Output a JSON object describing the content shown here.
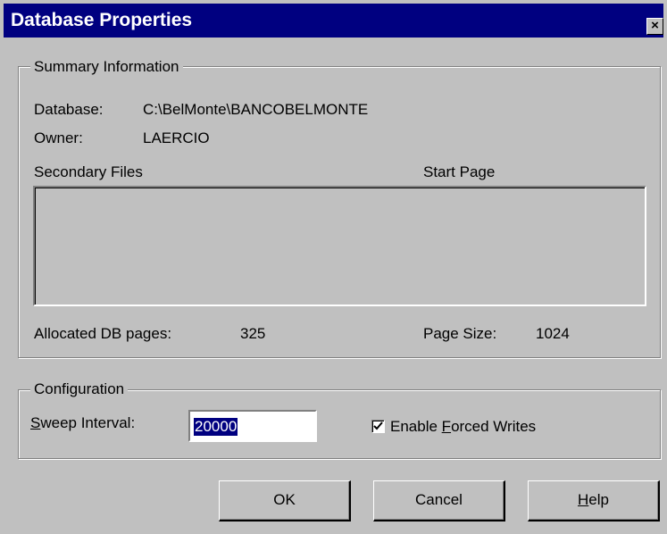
{
  "window": {
    "title": "Database Properties",
    "close_glyph": "×"
  },
  "summary": {
    "legend": "Summary Information",
    "database_label": "Database:",
    "database_value": "C:\\BelMonte\\BANCOBELMONTE",
    "owner_label": "Owner:",
    "owner_value": "LAERCIO",
    "secondary_files_header": "Secondary Files",
    "start_page_header": "Start Page",
    "secondary_files": [],
    "allocated_label": "Allocated DB pages:",
    "allocated_value": "325",
    "page_size_label": "Page Size:",
    "page_size_value": "1024"
  },
  "configuration": {
    "legend": "Configuration",
    "sweep_label_accel": "S",
    "sweep_label_rest": "weep Interval:",
    "sweep_value": "20000",
    "forced_writes_checked": true,
    "forced_label_pre": "Enable ",
    "forced_label_accel": "F",
    "forced_label_post": "orced Writes"
  },
  "buttons": {
    "ok": "OK",
    "cancel": "Cancel",
    "help_accel": "H",
    "help_rest": "elp"
  }
}
